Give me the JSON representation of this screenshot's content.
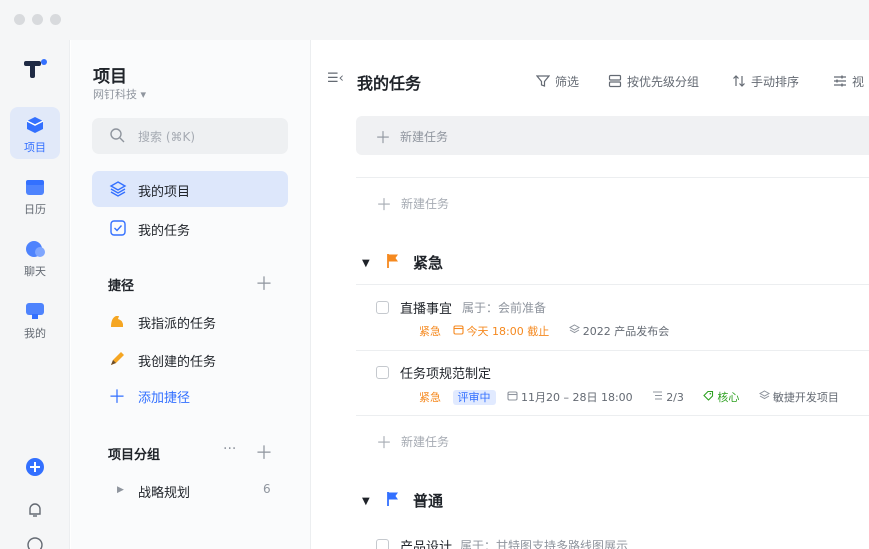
{
  "rail": {
    "items": [
      {
        "label": "项目"
      },
      {
        "label": "日历"
      },
      {
        "label": "聊天"
      },
      {
        "label": "我的"
      }
    ]
  },
  "sidebar": {
    "project_title": "项目",
    "org_name": "网钉科技 ▾",
    "search_placeholder": "搜索 (⌘K)",
    "nav": [
      {
        "label": "我的项目"
      },
      {
        "label": "我的任务"
      }
    ],
    "shortcuts_title": "捷径",
    "shortcuts": [
      {
        "label": "我指派的任务"
      },
      {
        "label": "我创建的任务"
      }
    ],
    "add_shortcut_label": "添加捷径",
    "groups_title": "项目分组",
    "groups": [
      {
        "label": "战略规划",
        "count": "6"
      }
    ]
  },
  "main": {
    "title": "我的任务",
    "toolbar": {
      "filter": "筛选",
      "group_by": "按优先级分组",
      "sort": "手动排序",
      "view": "视"
    },
    "new_task_label": "新建任务",
    "groups": [
      {
        "label": "紧急",
        "flag_color": "#f5891f",
        "tasks": [
          {
            "name": "直播事宜",
            "belong": "属于：会前准备",
            "priority": "紧急",
            "due": "今天 18:00 截止",
            "project": "2022 产品发布会"
          },
          {
            "name": "任务项规范制定",
            "priority": "紧急",
            "status": "评审中",
            "date_range": "11月20 – 28日 18:00",
            "subtasks": "2/3",
            "tag": "核心",
            "project": "敏捷开发项目"
          }
        ]
      },
      {
        "label": "普通",
        "flag_color": "#3370ff",
        "tasks": [
          {
            "name": "产品设计",
            "belong": "属于：甘特图支持多路线图展示"
          }
        ]
      }
    ]
  },
  "colors": {
    "accent": "#3370ff",
    "urgent": "#f5891f",
    "green": "#2ea121"
  }
}
